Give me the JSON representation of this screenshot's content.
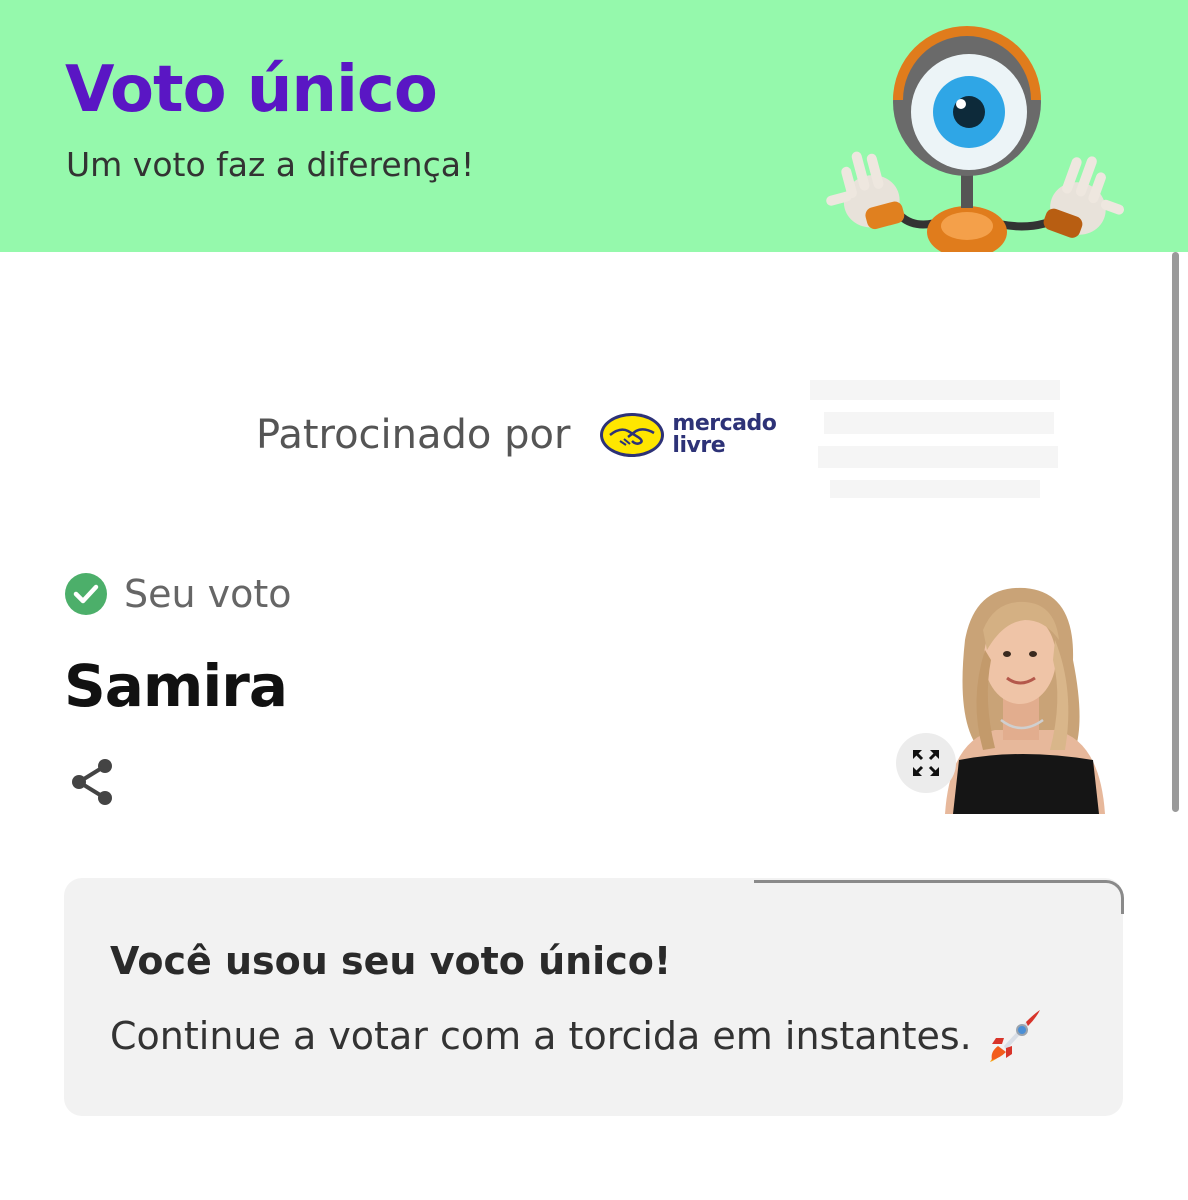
{
  "header": {
    "title": "Voto único",
    "subtitle": "Um voto faz a diferença!",
    "background": "#95f9ac",
    "title_color": "#5a16c4",
    "mascot_icon": "big-brother-eye-mascot"
  },
  "sponsor": {
    "label": "Patrocinado por",
    "brand_line1": "mercado",
    "brand_line2": "livre",
    "brand_icon": "handshake-logo-icon"
  },
  "vote": {
    "status_label": "Seu voto",
    "status_icon": "check-circle-icon",
    "status_color": "#4caf6a",
    "candidate_name": "Samira",
    "share_icon": "share-icon",
    "expand_icon": "expand-icon"
  },
  "notice": {
    "title": "Você usou seu voto único!",
    "text": "Continue a votar com a torcida em instantes.",
    "emoji_icon": "rocket-icon"
  }
}
